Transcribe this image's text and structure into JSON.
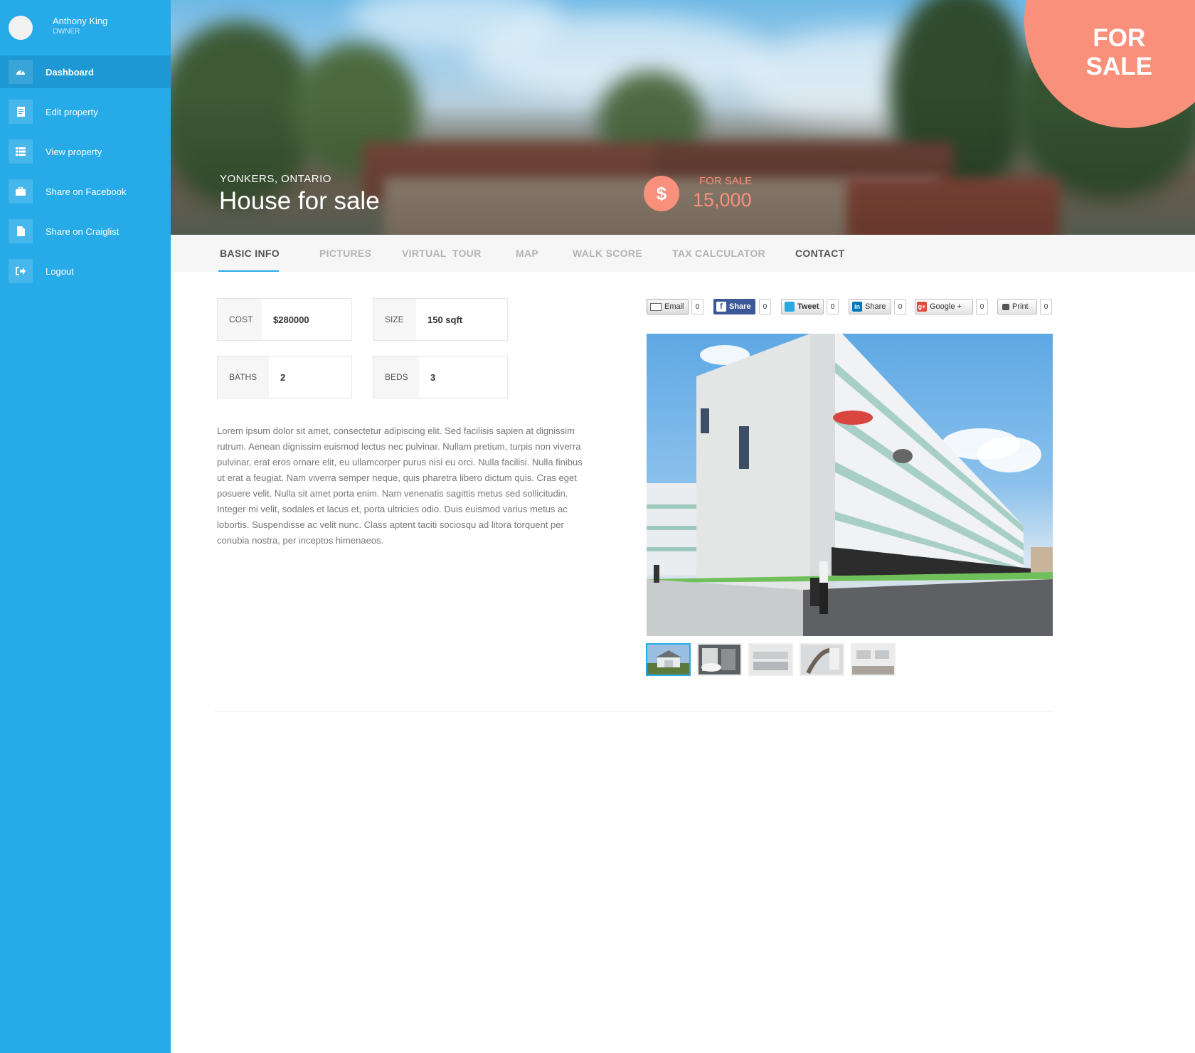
{
  "user": {
    "name": "Anthony King",
    "role": "OWNER"
  },
  "sidebar": {
    "items": [
      {
        "label": "Dashboard",
        "icon": "dashboard-icon"
      },
      {
        "label": "Edit property",
        "icon": "document-icon"
      },
      {
        "label": "View property",
        "icon": "list-icon"
      },
      {
        "label": "Share on Facebook",
        "icon": "briefcase-icon"
      },
      {
        "label": "Share on Craiglist",
        "icon": "file-icon"
      },
      {
        "label": "Logout",
        "icon": "logout-icon"
      }
    ]
  },
  "hero": {
    "location": "YONKERS, ONTARIO",
    "title": "House for sale",
    "price_symbol": "$",
    "price_label": "FOR SALE",
    "price_value": "15,000",
    "badge": [
      "FOR",
      "SALE"
    ]
  },
  "tabs": [
    {
      "label": "BASIC INFO"
    },
    {
      "label": "PICTURES"
    },
    {
      "label": "VIRTUAL  TOUR"
    },
    {
      "label": "MAP"
    },
    {
      "label": "WALK SCORE"
    },
    {
      "label": "TAX CALCULATOR"
    },
    {
      "label": "CONTACT"
    }
  ],
  "facts": [
    {
      "label": "COST",
      "value": "$280000"
    },
    {
      "label": "SIZE",
      "value": "150 sqft"
    },
    {
      "label": "BATHS",
      "value": "2"
    },
    {
      "label": "BEDS",
      "value": "3"
    }
  ],
  "description": "Lorem ipsum dolor sit amet, consectetur adipiscing elit. Sed facilisis sapien at dignissim rutrum. Aenean dignissim euismod lectus nec pulvinar. Nullam pretium, turpis non viverra pulvinar, erat eros ornare elit, eu ullamcorper purus nisi eu orci. Nulla facilisi. Nulla finibus ut erat a feugiat. Nam viverra semper neque, quis pharetra libero dictum quis. Cras eget posuere velit. Nulla sit amet porta enim. Nam venenatis sagittis metus sed sollicitudin. Integer mi velit, sodales et lacus et, porta ultricies odio. Duis euismod varius metus ac lobortis. Suspendisse ac velit nunc. Class aptent taciti sociosqu ad litora torquent per conubia nostra, per inceptos himenaeos.",
  "share": [
    {
      "label": "Email",
      "count": "0",
      "icon": "email-icon"
    },
    {
      "label": "Share",
      "count": "0",
      "icon": "facebook-icon"
    },
    {
      "label": "Tweet",
      "count": "0",
      "icon": "twitter-icon"
    },
    {
      "label": "Share",
      "count": "0",
      "icon": "linkedin-icon"
    },
    {
      "label": "Google +",
      "count": "0",
      "icon": "google-plus-icon"
    },
    {
      "label": "Print",
      "count": "0",
      "icon": "print-icon"
    }
  ],
  "colors": {
    "accent": "#27aae8",
    "sale": "#f9907c"
  }
}
